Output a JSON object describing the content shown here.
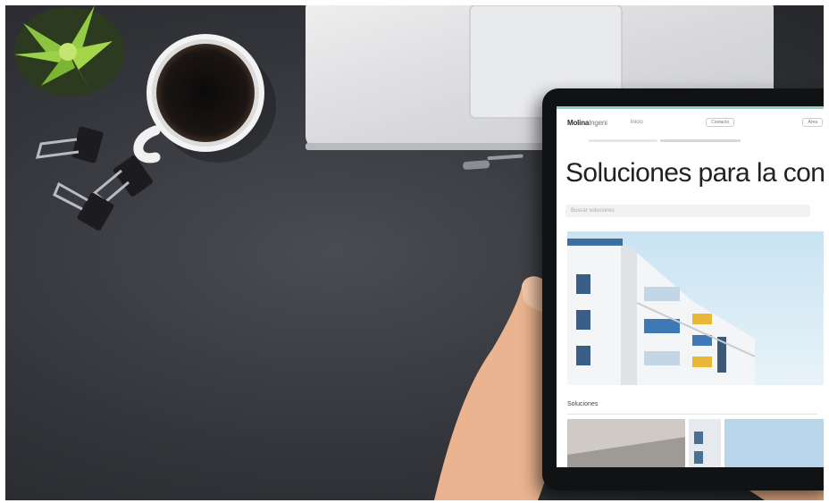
{
  "scene": {
    "tablet_page": {
      "logo_bold": "Molina",
      "logo_light": "Ingeni",
      "nav_link": "Inicio",
      "nav_button_1": "Contacto",
      "nav_button_2": "Área",
      "headline": "Soluciones para la cons",
      "search_placeholder": "Buscar soluciones",
      "section_label": "Soluciones"
    }
  }
}
